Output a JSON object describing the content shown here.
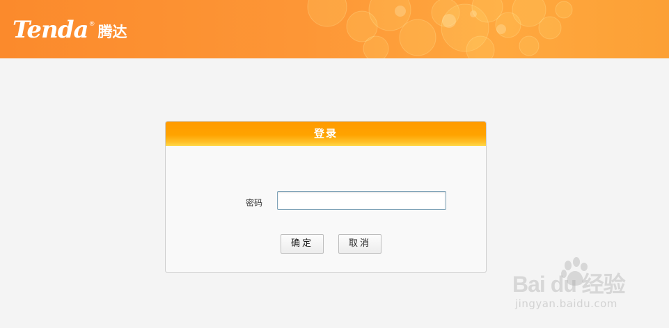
{
  "header": {
    "logo_en": "Tenda",
    "logo_reg": "®",
    "logo_cn": "腾达"
  },
  "login": {
    "title": "登录",
    "password_label": "密码",
    "password_value": "",
    "ok_label": "确定",
    "cancel_label": "取消"
  },
  "watermark": {
    "main": "Bai du 经验",
    "sub": "jingyan.baidu.com"
  },
  "colors": {
    "header_orange": "#fd9636",
    "title_bar_orange": "#ffa300",
    "input_border": "#7fa3b8"
  },
  "icons": {
    "watermark_logo": "baidu-paw-icon"
  }
}
